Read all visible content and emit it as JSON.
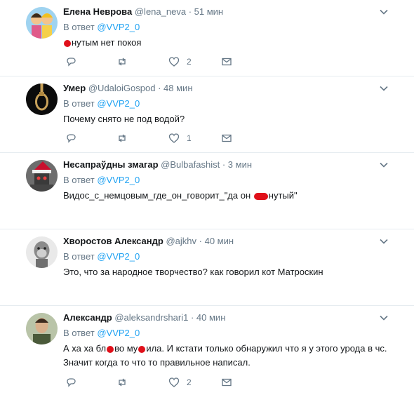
{
  "reply_prefix": "В ответ",
  "reply_mention": "@VVP2_0",
  "tweets": [
    {
      "name": "Елена Неврова",
      "handle": "@lena_neva",
      "separator": "·",
      "time": "51 мин",
      "text_before": "",
      "text_after": "нутым нет покоя",
      "like_count": "2",
      "avatar_icon": "cartoon-girls-avatar"
    },
    {
      "name": "Умер",
      "handle": "@UdaloiGospod",
      "separator": "·",
      "time": "48 мин",
      "text": "Почему снято не под водой?",
      "like_count": "1",
      "avatar_icon": "noose-avatar"
    },
    {
      "name": "Несапраўдны змагар",
      "handle": "@Bulbafashist",
      "separator": "·",
      "time": "3 мин",
      "text_before": "Видос_с_немцовым_где_он_говорит_\"да он ",
      "text_after": "нутый\"",
      "like_count": "",
      "avatar_icon": "santa-robot-avatar"
    },
    {
      "name": "Хворостов Александр",
      "handle": "@ajkhv",
      "separator": "·",
      "time": "40 мин",
      "text": "Это, что за народное творчество? как говорил кот Матроскин",
      "like_count": "",
      "avatar_icon": "monkey-avatar"
    },
    {
      "name": "Александр",
      "handle": "@aleksandrshari1",
      "separator": "·",
      "time": "40 мин",
      "text_p1": "А ха ха бл",
      "text_p2": "во му",
      "text_p3": "ила. И кстати только обнаружил что я у этого урода в чс.",
      "text_line2": "Значит когда то что то правильное написал.",
      "like_count": "2",
      "avatar_icon": "man-photo-avatar"
    }
  ],
  "icons": {
    "reply": "reply-icon",
    "retweet": "retweet-icon",
    "like": "heart-icon",
    "dm": "envelope-icon",
    "menu": "chevron-down-icon"
  },
  "colors": {
    "text": "#14171a",
    "secondary": "#657786",
    "link": "#1da1f2",
    "divider": "#e6ecf0",
    "censor": "#e0101a"
  }
}
